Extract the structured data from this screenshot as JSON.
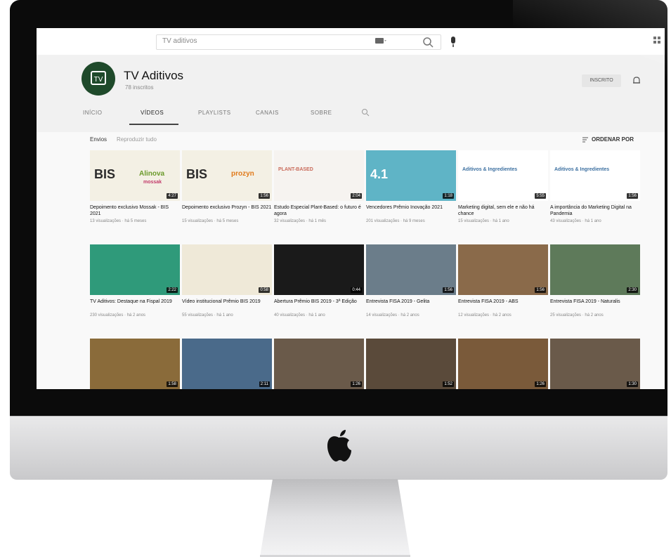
{
  "colors": {
    "accent": "#1f4a2b",
    "bezel": "#0b0b0b",
    "screen_bg": "#f9f9f9"
  },
  "header": {
    "search_placeholder": "TV aditivos"
  },
  "channel": {
    "name": "TV Aditivos",
    "subscribers": "78 inscritos",
    "subscribe_label": "INSCRITO"
  },
  "tabs": [
    {
      "label": "INÍCIO"
    },
    {
      "label": "VÍDEOS"
    },
    {
      "label": "PLAYLISTS"
    },
    {
      "label": "CANAIS"
    },
    {
      "label": "SOBRE"
    }
  ],
  "subheader": {
    "uploads": "Envios",
    "filter": "Reproduzir tudo",
    "sort": "ORDENAR POR"
  },
  "videos": [
    {
      "title": "Depoimento exclusivo Mossak - BIS 2021",
      "meta": "13 visualizações · há 5 meses",
      "duration": "4:27",
      "thumb_text": "BIS",
      "thumb_brand": "Alinova",
      "thumb_sub": "mossak"
    },
    {
      "title": "Depoimento exclusivo Prozyn - BIS 2021",
      "meta": "15 visualizações · há 5 meses",
      "duration": "1:56",
      "thumb_text": "BIS",
      "thumb_brand": "prozyn"
    },
    {
      "title": "Estudo Especial Plant-Based: o futuro é agora",
      "meta": "32 visualizações · há 1 mês",
      "duration": "2:04",
      "thumb_text": "PLANT-BASED"
    },
    {
      "title": "Vencedores Prêmio Inovação 2021",
      "meta": "201 visualizações · há 9 meses",
      "duration": "1:18",
      "thumb_text": "4.1"
    },
    {
      "title": "Marketing digital, sem ele e não há chance",
      "meta": "15 visualizações · há 1 ano",
      "duration": "5:55",
      "thumb_text": "Aditivos & Ingredientes"
    },
    {
      "title": "A importância do Marketing Digital na Pandemia",
      "meta": "43 visualizações · há 1 ano",
      "duration": "1:56",
      "thumb_text": "Aditivos & Ingredientes"
    },
    {
      "title": "TV Aditivos: Destaque na Fispal 2019",
      "meta": "230 visualizações · há 2 anos",
      "duration": "2:22"
    },
    {
      "title": "Vídeo institucional Prêmio BIS 2019",
      "meta": "55 visualizações · há 1 ano",
      "duration": "0:58"
    },
    {
      "title": "Abertura Prêmio BIS 2019 - 3ª Edição",
      "meta": "40 visualizações · há 1 ano",
      "duration": "0:44"
    },
    {
      "title": "Entrevista FISA 2019 - Gelita",
      "meta": "14 visualizações · há 2 anos",
      "duration": "1:56"
    },
    {
      "title": "Entrevista FISA 2019 - ABS",
      "meta": "12 visualizações · há 2 anos",
      "duration": "1:56"
    },
    {
      "title": "Entrevista FISA 2019 - Naturalis",
      "meta": "25 visualizações · há 2 anos",
      "duration": "2:30"
    },
    {
      "title": "",
      "meta": "",
      "duration": "1:58"
    },
    {
      "title": "",
      "meta": "",
      "duration": "2:11"
    },
    {
      "title": "",
      "meta": "",
      "duration": "1:26"
    },
    {
      "title": "",
      "meta": "",
      "duration": "1:52"
    },
    {
      "title": "",
      "meta": "",
      "duration": "1:26"
    },
    {
      "title": "",
      "meta": "",
      "duration": "1:30"
    }
  ]
}
